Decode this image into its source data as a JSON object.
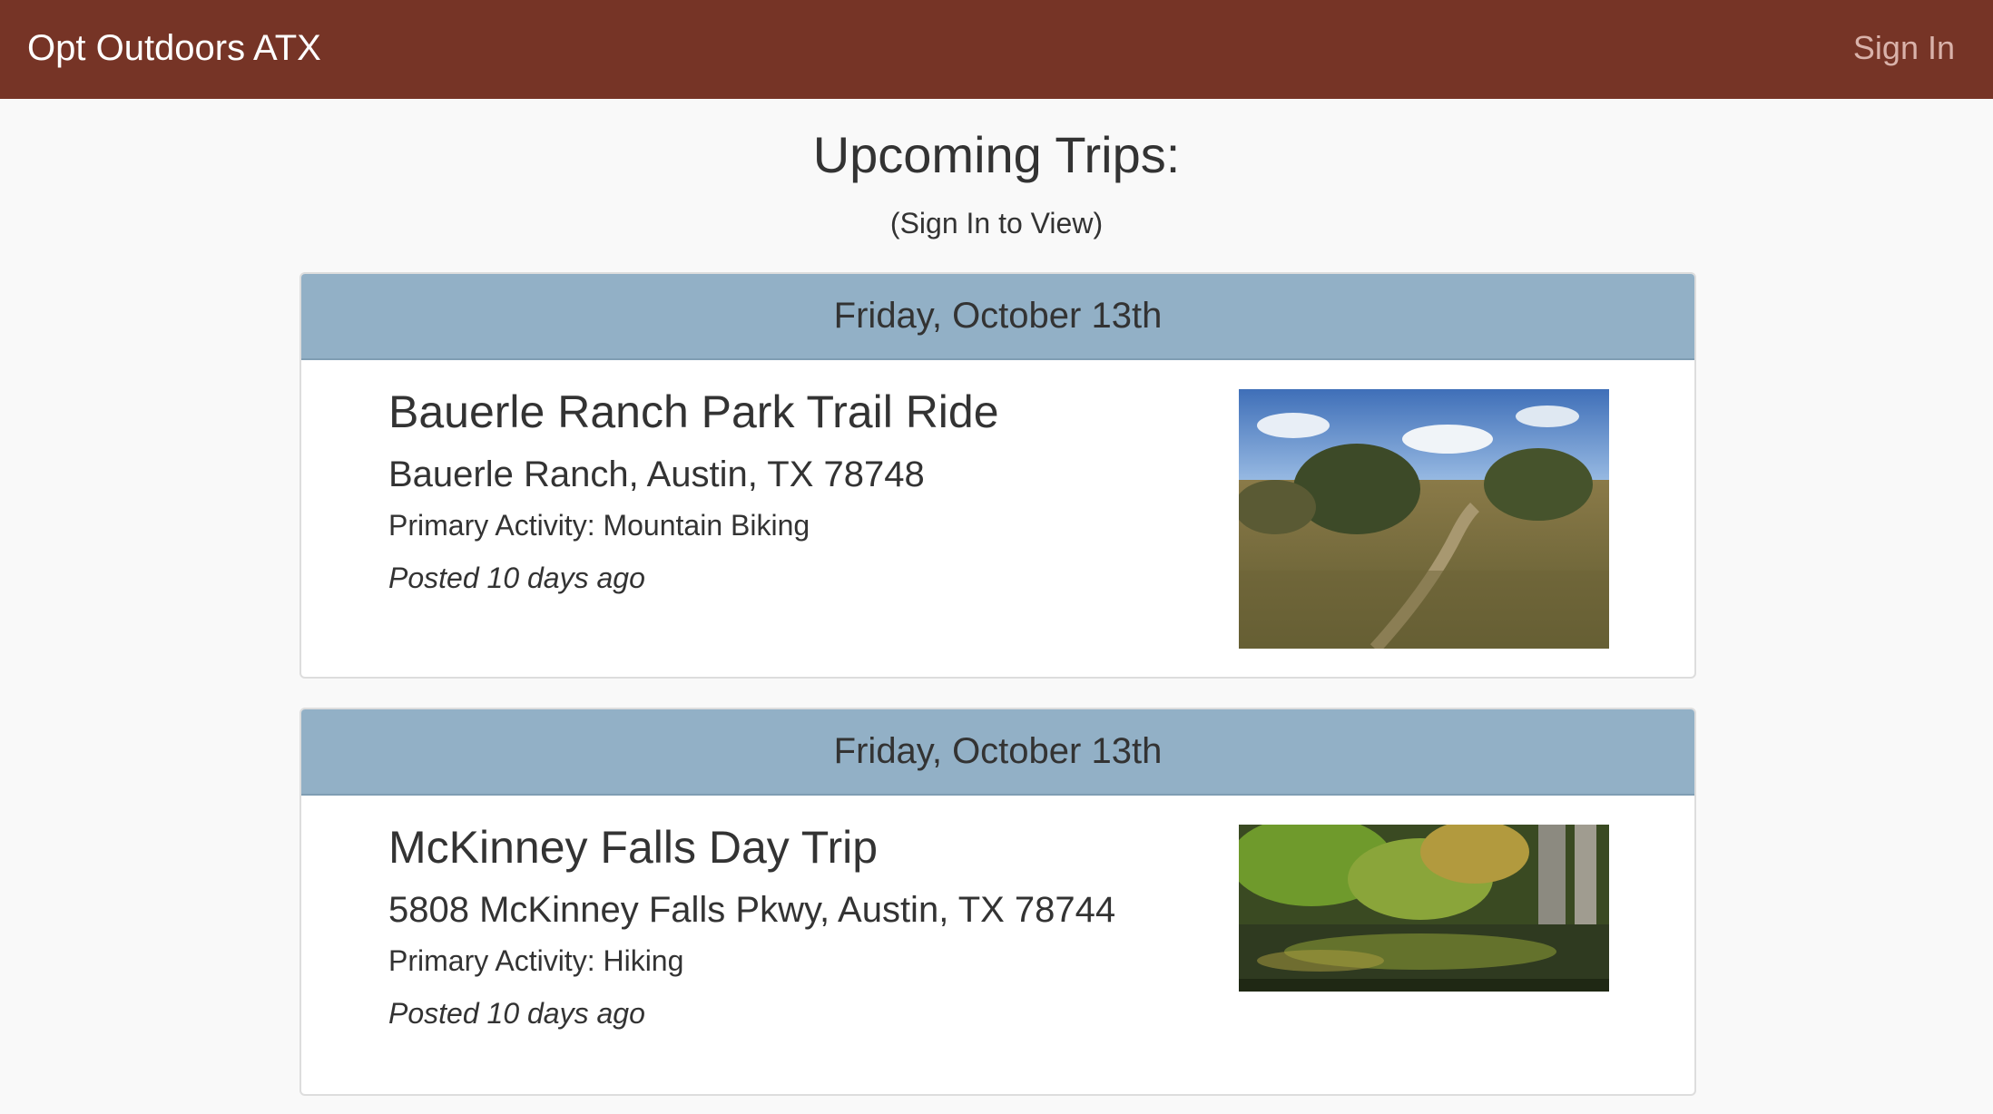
{
  "navbar": {
    "brand": "Opt Outdoors ATX",
    "sign_in_label": "Sign In"
  },
  "page": {
    "title": "Upcoming Trips:",
    "subtitle": "(Sign In to View)"
  },
  "trips": [
    {
      "date": "Friday, October 13th",
      "name": "Bauerle Ranch Park Trail Ride",
      "address": "Bauerle Ranch, Austin, TX 78748",
      "activity": "Primary Activity: Mountain Biking",
      "posted": "Posted 10 days ago",
      "image_icon": "trail-photo"
    },
    {
      "date": "Friday, October 13th",
      "name": "McKinney Falls Day Trip",
      "address": "5808 McKinney Falls Pkwy, Austin, TX 78744",
      "activity": "Primary Activity: Hiking",
      "posted": "Posted 10 days ago",
      "image_icon": "creek-photo"
    }
  ],
  "colors": {
    "navbar": "#763426",
    "panel_heading": "#92b0c6",
    "background": "#f9f9f9"
  }
}
